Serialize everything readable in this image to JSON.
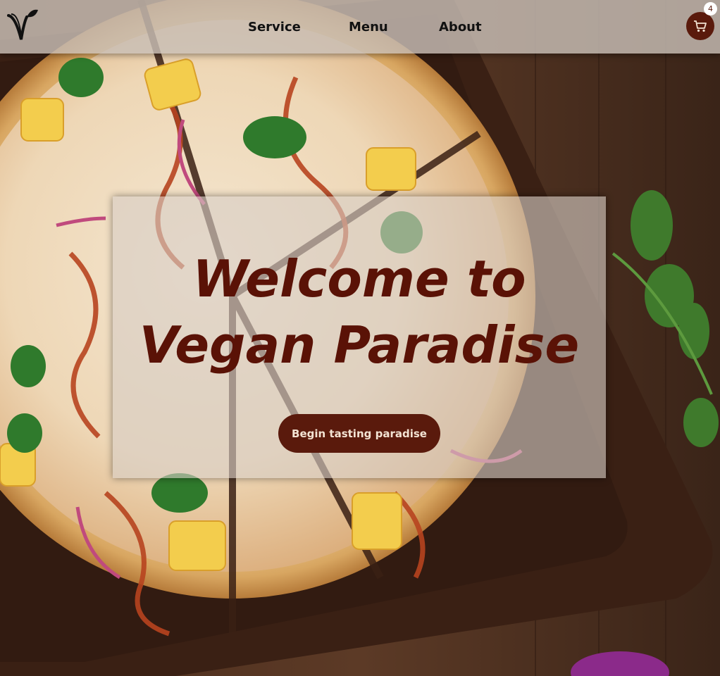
{
  "nav": {
    "items": [
      {
        "label": "Service"
      },
      {
        "label": "Menu"
      },
      {
        "label": "About"
      }
    ],
    "cart_count": "4",
    "cart_icon": "shopping-cart-icon",
    "logo_icon": "vegan-v-leaf-logo"
  },
  "hero": {
    "title_line1": "Welcome to",
    "title_line2": "Vegan Paradise",
    "cta_label": "Begin tasting paradise"
  },
  "colors": {
    "brand": "#5a1a0c",
    "title": "#5a1206",
    "header_bg": "#c8beb6"
  }
}
